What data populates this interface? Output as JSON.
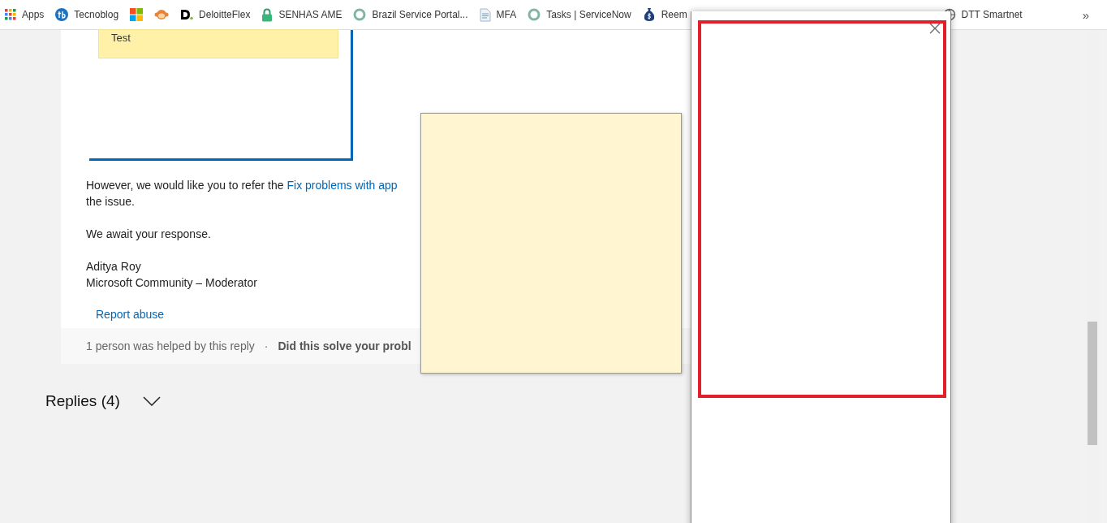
{
  "bookmarks": [
    {
      "kind": "labeled",
      "label": "Apps"
    },
    {
      "kind": "labeled",
      "label": "Tecnoblog"
    },
    {
      "kind": "icon"
    },
    {
      "kind": "icon"
    },
    {
      "kind": "labeled",
      "label": "DeloitteFlex"
    },
    {
      "kind": "labeled",
      "label": "SENHAS AME"
    },
    {
      "kind": "labeled",
      "label": "Brazil Service Portal..."
    },
    {
      "kind": "labeled",
      "label": "MFA"
    },
    {
      "kind": "labeled",
      "label": "Tasks | ServiceNow"
    },
    {
      "kind": "labeled",
      "label": "Reem"
    }
  ],
  "bookmarks_end": {
    "label": "DTT Smartnet"
  },
  "overflow": "»",
  "post": {
    "note_text": "Test",
    "paragraph": {
      "before": "However, we would like you to refer the ",
      "link": "Fix problems with app",
      "after": "the issue."
    },
    "closing": "We await your response.",
    "signature": [
      "Aditya Roy",
      "Microsoft Community – Moderator"
    ],
    "report_link": "Report abuse",
    "helped": "1 person was helped by this reply",
    "separator": "·",
    "question": "Did this solve your probl"
  },
  "replies": {
    "label": "Replies (4)"
  }
}
